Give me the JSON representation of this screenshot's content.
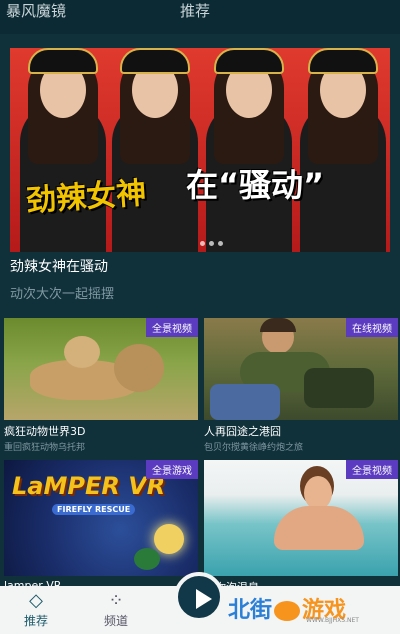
{
  "header": {
    "app_title": "暴风魔镜",
    "tab_title": "推荐"
  },
  "banner": {
    "overlay_text_left": "劲辣女神",
    "overlay_text_right": "在“骚动”"
  },
  "feature": {
    "title": "劲辣女神在骚动",
    "subtitle": "动次大次一起摇摆"
  },
  "cards": [
    {
      "badge": "全景视频",
      "title": "疯狂动物世界3D",
      "subtitle": "重回疯狂动物乌托邦"
    },
    {
      "badge": "在线视频",
      "title": "人再囧途之港囧",
      "subtitle": "包贝尔搅黄徐峥约炮之旅"
    },
    {
      "badge": "全景游戏",
      "title": "lamper VR",
      "subtitle": "",
      "art_text": "LaMPER VR",
      "art_sub": "FIREFLY RESCUE"
    },
    {
      "badge": "全景视频",
      "title": "陪你泡温泉",
      "subtitle": ""
    }
  ],
  "bottom_nav": {
    "items": [
      {
        "label": "推荐",
        "icon": "diamond-icon"
      },
      {
        "label": "频道",
        "icon": "grid-icon"
      }
    ],
    "play_icon": "play-icon"
  },
  "watermark": {
    "text_left": "北街",
    "text_right": "游戏",
    "url": "WWW.BJJHXS.NET"
  },
  "colors": {
    "background": "#10303a",
    "badge": "#5b3cc0",
    "muted_text": "#7f98a1",
    "nav_bg": "#f3f4f4"
  }
}
